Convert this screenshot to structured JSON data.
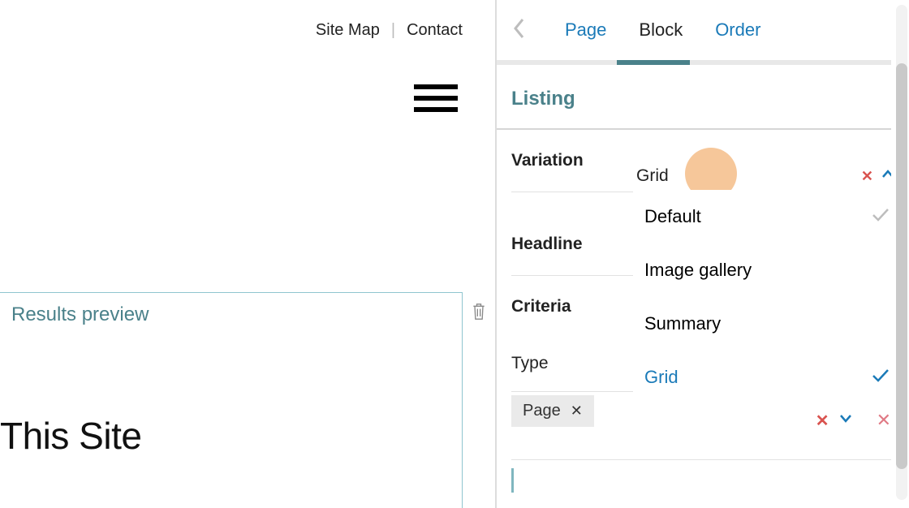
{
  "topnav": {
    "site_map": "Site Map",
    "separator": "|",
    "contact": "Contact"
  },
  "left": {
    "results_title": "Results preview",
    "heading": "This Site"
  },
  "panel": {
    "tabs": {
      "page": "Page",
      "block": "Block",
      "order": "Order",
      "active": "block"
    },
    "section_title": "Listing",
    "fields": {
      "variation_label": "Variation",
      "variation_value": "Grid",
      "headline_label": "Headline",
      "criteria_label": "Criteria",
      "type_label": "Type"
    },
    "variation_options": [
      {
        "label": "Default",
        "selected": false
      },
      {
        "label": "Image gallery",
        "selected": false
      },
      {
        "label": "Summary",
        "selected": false
      },
      {
        "label": "Grid",
        "selected": true
      }
    ],
    "chip": {
      "label": "Page"
    }
  },
  "icons": {
    "hamburger": "hamburger-icon",
    "trash": "trash-icon",
    "back": "chevron-left-icon",
    "close": "close-icon",
    "chev_up": "chevron-up-icon",
    "chev_down": "chevron-down-icon",
    "check": "check-icon"
  },
  "colors": {
    "teal": "#4a818a",
    "link_blue": "#1a7ab8",
    "danger": "#d9534f",
    "highlight_circle": "#f6c79a"
  }
}
